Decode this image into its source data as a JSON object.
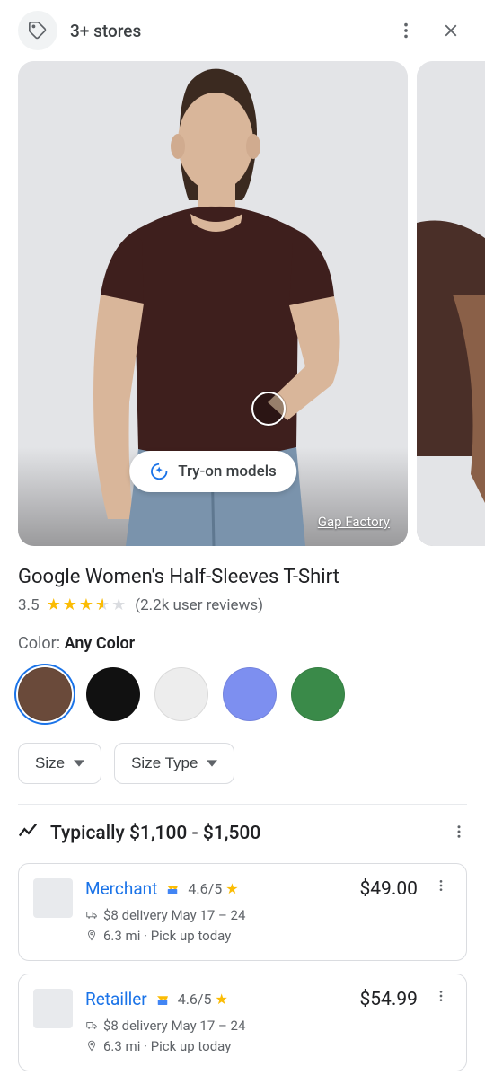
{
  "header": {
    "stores_label": "3+ stores"
  },
  "gallery": {
    "tryon_label": "Try-on models",
    "attribution": "Gap Factory"
  },
  "product": {
    "title": "Google Women's Half-Sleeves T-Shirt",
    "rating_value": "3.5",
    "reviews_text": "(2.2k user reviews)",
    "color_prefix": "Color: ",
    "color_value": "Any Color",
    "swatches": [
      {
        "name": "brown",
        "hex": "#6a4a3a",
        "selected": true
      },
      {
        "name": "black",
        "hex": "#111111",
        "selected": false
      },
      {
        "name": "light-gray",
        "hex": "#ededed",
        "selected": false
      },
      {
        "name": "periwinkle",
        "hex": "#7d8ff0",
        "selected": false
      },
      {
        "name": "green",
        "hex": "#3a8a49",
        "selected": false
      }
    ],
    "filters": {
      "size_label": "Size",
      "size_type_label": "Size Type"
    }
  },
  "pricing": {
    "typically_label": "Typically $1,100 - $1,500"
  },
  "offers": [
    {
      "name": "Merchant",
      "rating": "4.6/5",
      "price": "$49.00",
      "delivery": "$8 delivery May 17 – 24",
      "pickup": "6.3 mi · Pick up today"
    },
    {
      "name": "Retailler",
      "rating": "4.6/5",
      "price": "$54.99",
      "delivery": "$8 delivery May 17 – 24",
      "pickup": "6.3 mi · Pick up today"
    }
  ]
}
